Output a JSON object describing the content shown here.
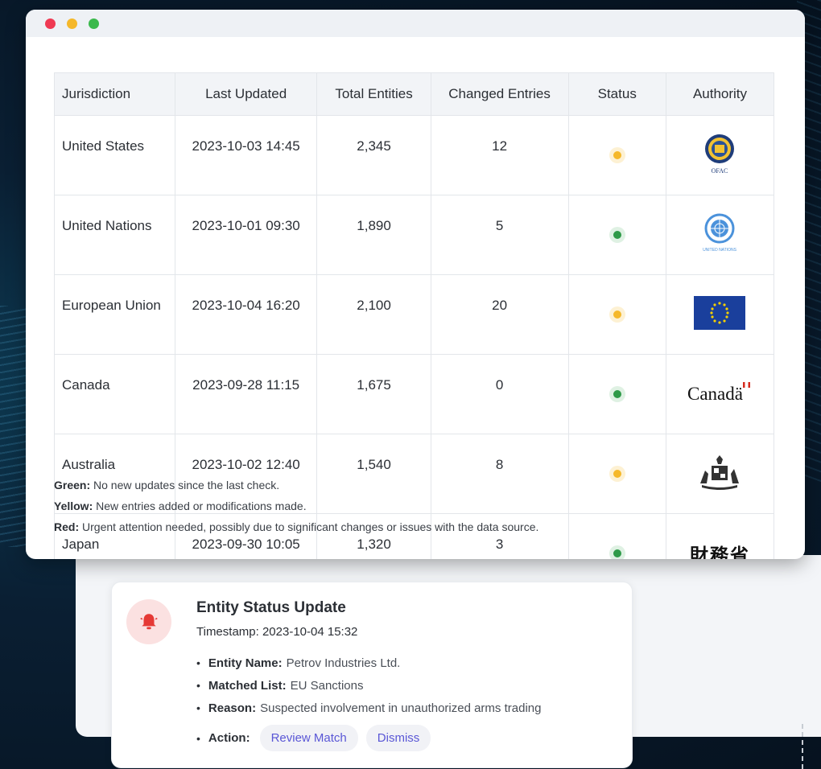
{
  "table": {
    "headers": [
      "Jurisdiction",
      "Last Updated",
      "Total Entities",
      "Changed Entries",
      "Status",
      "Authority"
    ],
    "rows": [
      {
        "jurisdiction": "United States",
        "last_updated": "2023-10-03 14:45",
        "total": "2,345",
        "changed": "12",
        "status": "yellow",
        "authority": "OFAC"
      },
      {
        "jurisdiction": "United Nations",
        "last_updated": "2023-10-01 09:30",
        "total": "1,890",
        "changed": "5",
        "status": "green",
        "authority": "UNITED NATIONS"
      },
      {
        "jurisdiction": "European Union",
        "last_updated": "2023-10-04 16:20",
        "total": "2,100",
        "changed": "20",
        "status": "yellow",
        "authority": "eu-flag"
      },
      {
        "jurisdiction": "Canada",
        "last_updated": "2023-09-28 11:15",
        "total": "1,675",
        "changed": "0",
        "status": "green",
        "authority": "Canadä"
      },
      {
        "jurisdiction": "Australia",
        "last_updated": "2023-10-02 12:40",
        "total": "1,540",
        "changed": "8",
        "status": "yellow",
        "authority": "australia-coat-of-arms"
      },
      {
        "jurisdiction": "Japan",
        "last_updated": "2023-09-30 10:05",
        "total": "1,320",
        "changed": "3",
        "status": "green",
        "authority": "財務省"
      }
    ]
  },
  "legend": [
    {
      "label": "Green:",
      "text": "No new updates since the last check."
    },
    {
      "label": "Yellow:",
      "text": "New entries added or modifications made."
    },
    {
      "label": "Red:",
      "text": "Urgent attention needed, possibly due to significant changes or issues with the data source."
    }
  ],
  "alert": {
    "title": "Entity Status Update",
    "timestamp": "Timestamp: 2023-10-04 15:32",
    "items": [
      {
        "label": "Entity Name:",
        "value": "Petrov Industries Ltd."
      },
      {
        "label": "Matched List:",
        "value": "EU Sanctions"
      },
      {
        "label": "Reason:",
        "value": "Suspected involvement in unauthorized arms trading"
      }
    ],
    "action_label": "Action:",
    "review_label": "Review Match",
    "dismiss_label": "Dismiss"
  },
  "colors": {
    "yellow": "#f5b82a",
    "green": "#2e9a48",
    "accent": "#5a57d6",
    "bell": "#e53935"
  }
}
